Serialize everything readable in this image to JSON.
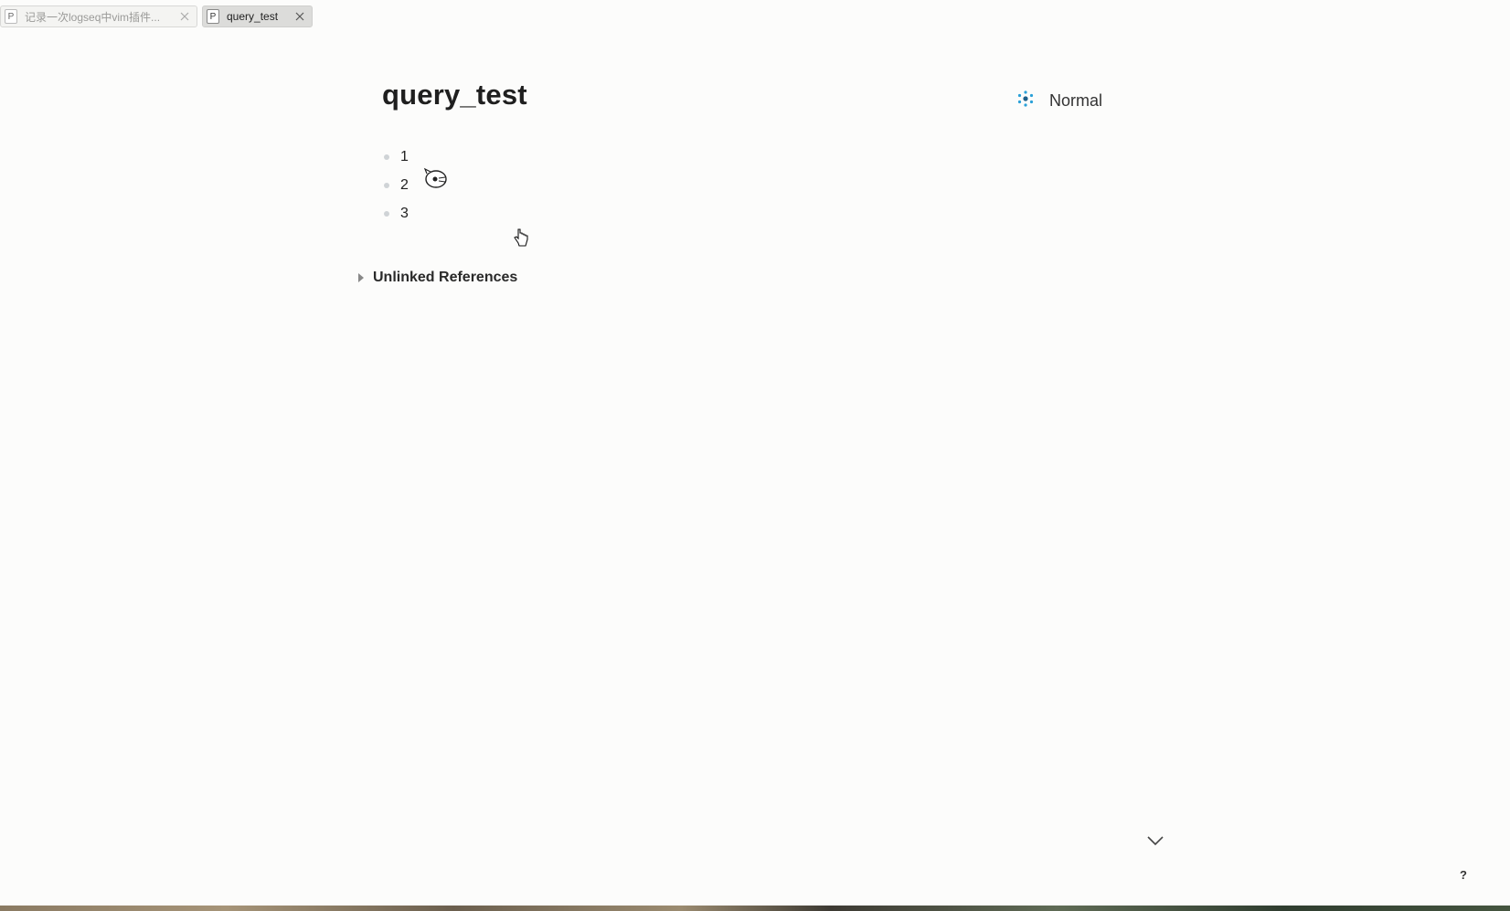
{
  "tabs": [
    {
      "icon_letter": "P",
      "title": "记录一次logseq中vim插件...",
      "active": false
    },
    {
      "icon_letter": "P",
      "title": "query_test",
      "active": true
    }
  ],
  "page": {
    "title": "query_test",
    "mode_label": "Normal",
    "blocks": [
      "1",
      "2",
      "3"
    ],
    "unlinked_references_label": "Unlinked References"
  },
  "help_label": "?",
  "colors": {
    "background": "#fcfcfb",
    "mode_icon_accent": "#2aa0d8"
  },
  "icons": {
    "tab_page": "page-icon",
    "tab_close": "close-icon",
    "mode": "vim-mode-icon",
    "collapse": "caret-right-icon",
    "scroll": "chevron-down-icon"
  }
}
